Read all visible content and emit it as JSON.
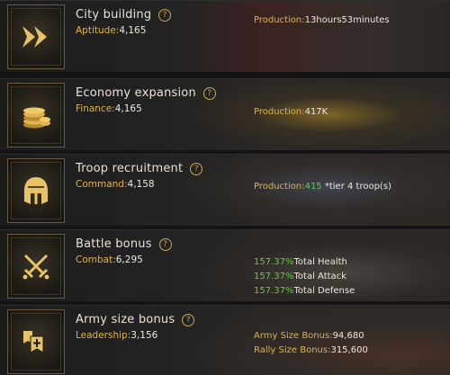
{
  "panels": [
    {
      "title": "City building",
      "stat_label": "Aptitude:",
      "stat_value": "4,165",
      "icon": "fast-forward-icon",
      "right": [
        {
          "label": "Production:",
          "value": "13hours53minutes"
        }
      ]
    },
    {
      "title": "Economy expansion",
      "stat_label": "Finance:",
      "stat_value": "4,165",
      "icon": "coins-icon",
      "right": [
        {
          "label": "Production:",
          "value": "417K"
        }
      ]
    },
    {
      "title": "Troop recruitment",
      "stat_label": "Command:",
      "stat_value": "4,158",
      "icon": "helmet-icon",
      "right": [
        {
          "label": "Production:",
          "value": "415",
          "suffix": " *tier 4 troop(s)"
        }
      ]
    },
    {
      "title": "Battle bonus",
      "stat_label": "Combat:",
      "stat_value": "6,295",
      "icon": "crossed-swords-icon",
      "right": [
        {
          "value": "157.37%",
          "label": "Total Health"
        },
        {
          "value": "157.37%",
          "label": "Total Attack"
        },
        {
          "value": "157.37%",
          "label": "Total Defense"
        }
      ]
    },
    {
      "title": "Army size bonus",
      "stat_label": "Leadership:",
      "stat_value": "3,156",
      "icon": "banner-plus-icon",
      "right": [
        {
          "label": "Army Size Bonus:",
          "value": "94,680"
        },
        {
          "label": "Rally Size Bonus:",
          "value": "315,600"
        }
      ]
    }
  ],
  "help_glyph": "?",
  "colors": {
    "gold": "#e0b34a",
    "green": "#5ad23a",
    "frame": "#6b5a3e"
  }
}
